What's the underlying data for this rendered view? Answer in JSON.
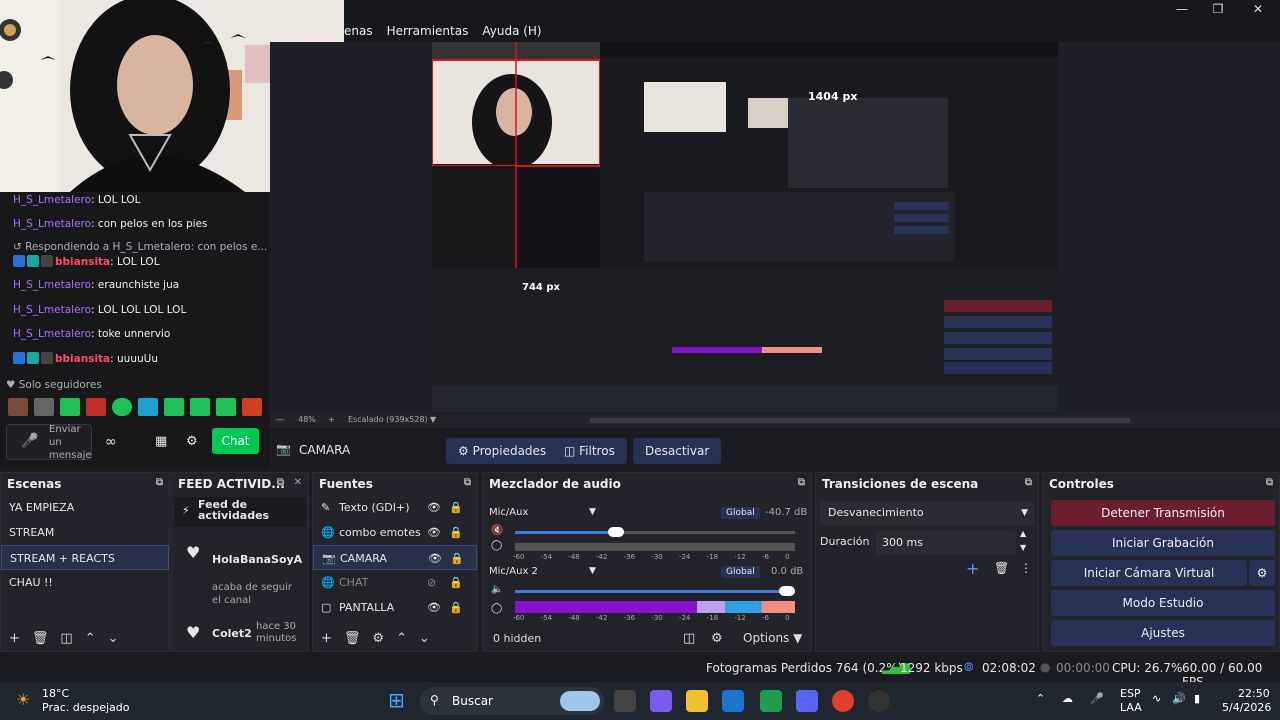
{
  "menu": {
    "items": [
      "enas",
      "Herramientas",
      "Ayuda (H)"
    ]
  },
  "chat": {
    "lines": [
      {
        "user": "H_S_Lmetalero",
        "text": ": LOL LOL"
      },
      {
        "user": "H_S_Lmetalero",
        "text": ": con pelos en los pies"
      },
      {
        "reply": "Respondiendo a H_S_Lmetalero: con pelos e..."
      },
      {
        "user": "bbiansita",
        "text": ": LOL LOL"
      },
      {
        "user": "H_S_Lmetalero",
        "text": ": eraunchiste jua"
      },
      {
        "user": "H_S_Lmetalero",
        "text": ": LOL LOL LOL LOL"
      },
      {
        "user": "H_S_Lmetalero",
        "text": ": toke unnervio"
      },
      {
        "user": "bbiansita",
        "text": ": uuuuUu"
      }
    ],
    "followers_only": "Solo seguidores",
    "input_placeholder": "Enviar un mensaje",
    "chat_button": "Chat"
  },
  "preview": {
    "measure_label": "1404 px",
    "measure_label_2": "744 px",
    "zoom": "48%",
    "scale_label": "Escalado (939x528)"
  },
  "source_toolbar": {
    "source_name": "CAMARA",
    "properties": "Propiedades",
    "filters": "Filtros",
    "deactivate": "Desactivar"
  },
  "scenes": {
    "title": "Escenas",
    "items": [
      "YA EMPIEZA",
      "STREAM",
      "STREAM + REACTS",
      "CHAU !!"
    ],
    "selected": 2
  },
  "feed": {
    "title": "FEED ACTIVID...",
    "inner_title": "Feed de actividades",
    "items": [
      {
        "name": "HolaBanaSoyA",
        "desc": "acaba de seguir el canal"
      },
      {
        "name": "Colet2",
        "desc": "hace 30 minutos"
      }
    ]
  },
  "sources": {
    "title": "Fuentes",
    "items": [
      "Texto (GDI+)",
      "combo emotes",
      "CAMARA",
      "CHAT",
      "PANTALLA"
    ]
  },
  "mixer": {
    "title": "Mezclador de audio",
    "channels": [
      {
        "name": "Mic/Aux",
        "badge": "Global",
        "db": "-40.7 dB",
        "level": 0.36
      },
      {
        "name": "Mic/Aux 2",
        "badge": "Global",
        "db": "0.0 dB",
        "level": 0.97
      }
    ],
    "scale": "-60 -54 -48 -42 -36 -30 -24 -18 -12 -6 0",
    "hidden": "0 hidden",
    "options": "Options"
  },
  "transitions": {
    "title": "Transiciones de escena",
    "type": "Desvanecimiento",
    "duration_label": "Duración",
    "duration_value": "300 ms"
  },
  "controls": {
    "title": "Controles",
    "buttons": [
      "Detener Transmisión",
      "Iniciar Grabación",
      "Iniciar Cámara Virtual",
      "Modo Estudio",
      "Ajustes"
    ]
  },
  "status": {
    "dropped": "Fotogramas Perdidos 764 (0.2%)",
    "kbps": "1292 kbps",
    "live_time": "02:08:02",
    "rec_time": "00:00:00",
    "cpu": "CPU: 26.7%",
    "fps": "60.00 / 60.00 FPS"
  },
  "taskbar": {
    "temp": "18°C",
    "weather": "Prac. despejado",
    "search": "Buscar",
    "lang1": "ESP",
    "lang2": "LAA",
    "time": "22:50",
    "date": "5/4/2026"
  },
  "colors": {
    "accent": "#283156",
    "stop": "#6a1e2e",
    "chat_green": "#00c853",
    "username": "#a970ff",
    "username_alt": "#ff4a6a"
  }
}
